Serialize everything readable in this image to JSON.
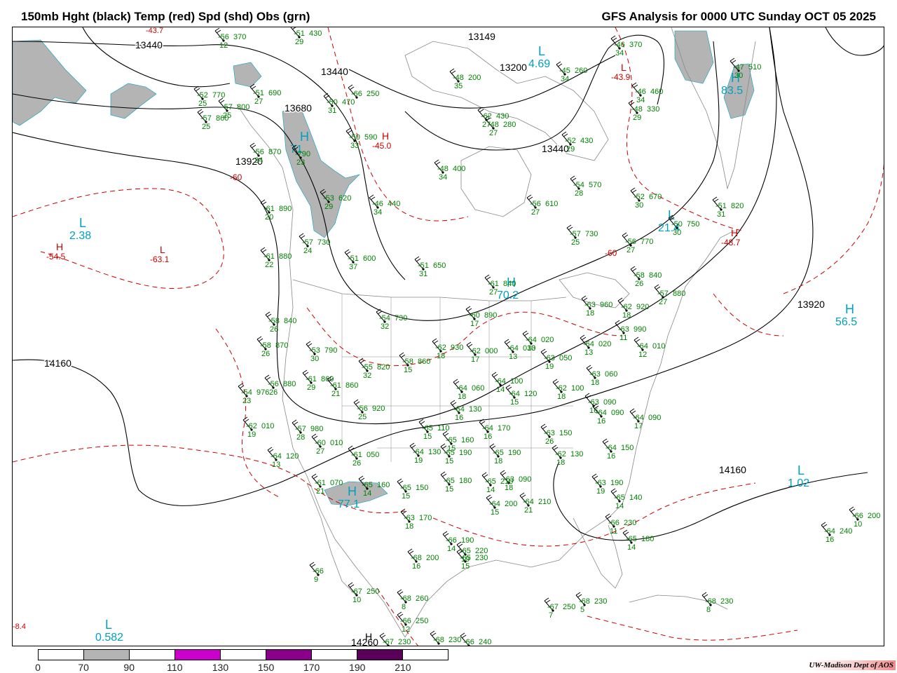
{
  "header": {
    "title_left": "150mb Hght (black) Temp (red) Spd (shd) Obs (grn)",
    "title_right": "GFS Analysis for 0000 UTC Sunday  OCT 05 2025"
  },
  "colors": {
    "height_contours": "#000000",
    "temperature_contours": "#cc0000",
    "observations": "#008000",
    "speed_labels": "#00a0c0",
    "geography": "#888888"
  },
  "height_labels": [
    "13440",
    "13149",
    "13200",
    "13440",
    "13680",
    "13920",
    "13440",
    "14160",
    "14160",
    "14260",
    "13920"
  ],
  "temperature_labels": [
    "-60",
    "-60"
  ],
  "centers": [
    {
      "letter": "L",
      "value": "2.38",
      "color": "cyan"
    },
    {
      "letter": "H",
      "value": "-54.5",
      "color": "red"
    },
    {
      "letter": "L",
      "value": "-63.1",
      "color": "red"
    },
    {
      "letter": "H",
      "value": "-45.0",
      "color": "red"
    },
    {
      "letter": "H",
      "value": "71",
      "color": "cyan"
    },
    {
      "letter": "L",
      "value": "4.69",
      "color": "cyan"
    },
    {
      "letter": "H",
      "value": "83.5",
      "color": "cyan"
    },
    {
      "letter": "H",
      "value": "-48.7",
      "color": "red"
    },
    {
      "letter": "H",
      "value": "70.2",
      "color": "cyan"
    },
    {
      "letter": "H",
      "value": "56.5",
      "color": "cyan"
    },
    {
      "letter": "L",
      "value": "1.02",
      "color": "cyan"
    },
    {
      "letter": "H",
      "value": "77.1",
      "color": "cyan"
    },
    {
      "letter": "L",
      "value": "0.582",
      "color": "cyan"
    },
    {
      "letter": "H",
      "value": "",
      "color": "black"
    },
    {
      "letter": "L",
      "value": "21.4",
      "color": "cyan"
    },
    {
      "letter": "L",
      "value": "-43.9",
      "color": "red"
    }
  ],
  "observations": [
    {
      "temp": "-51",
      "height": "430",
      "dew": "29"
    },
    {
      "temp": "-46",
      "height": "370",
      "dew": "34"
    },
    {
      "temp": "-45",
      "height": "260",
      "dew": "34"
    },
    {
      "temp": "-46",
      "height": "460",
      "dew": "34"
    },
    {
      "temp": "-48",
      "height": "200",
      "dew": "35"
    },
    {
      "temp": "-51",
      "height": "690",
      "dew": "27"
    },
    {
      "temp": "-52",
      "height": "770",
      "dew": "25"
    },
    {
      "temp": "-57",
      "height": "800",
      "dew": "25"
    },
    {
      "temp": "-57",
      "height": "860",
      "dew": "25"
    },
    {
      "temp": "-50",
      "height": "470",
      "dew": "31"
    },
    {
      "temp": "-48",
      "height": "280",
      "dew": "27"
    },
    {
      "temp": "-50",
      "height": "590",
      "dew": "33"
    },
    {
      "temp": "-52",
      "height": "430",
      "dew": "29"
    },
    {
      "temp": "-56",
      "height": "870",
      "dew": "24"
    },
    {
      "temp": "-790",
      "height": "",
      "dew": "23"
    },
    {
      "temp": "-48",
      "height": "400",
      "dew": "34"
    },
    {
      "temp": "-46",
      "height": "440",
      "dew": "34"
    },
    {
      "temp": "-54",
      "height": "570",
      "dew": "28"
    },
    {
      "temp": "-52",
      "height": "670",
      "dew": "30"
    },
    {
      "temp": "-51",
      "height": "820",
      "dew": "31"
    },
    {
      "temp": "-61",
      "height": "890",
      "dew": "20"
    },
    {
      "temp": "-53",
      "height": "620",
      "dew": "29"
    },
    {
      "temp": "-57",
      "height": "730",
      "dew": "24"
    },
    {
      "temp": "-56",
      "height": "610",
      "dew": "27"
    },
    {
      "temp": "-57",
      "height": "730",
      "dew": "25"
    },
    {
      "temp": "-50",
      "height": "750",
      "dew": "30"
    },
    {
      "temp": "-56",
      "height": "770",
      "dew": "27"
    },
    {
      "temp": "-51",
      "height": "600",
      "dew": "37"
    },
    {
      "temp": "-61",
      "height": "880",
      "dew": "22"
    },
    {
      "temp": "-51",
      "height": "650",
      "dew": "31"
    },
    {
      "temp": "-61",
      "height": "840",
      "dew": "27"
    },
    {
      "temp": "-58",
      "height": "840",
      "dew": "26"
    },
    {
      "temp": "-57",
      "height": "880",
      "dew": "27"
    },
    {
      "temp": "-63",
      "height": "960",
      "dew": "18"
    },
    {
      "temp": "-62",
      "height": "920",
      "dew": "18"
    },
    {
      "temp": "-54",
      "height": "730",
      "dew": "32"
    },
    {
      "temp": "-60",
      "height": "890",
      "dew": "17"
    },
    {
      "temp": "-58",
      "height": "840",
      "dew": "26"
    },
    {
      "temp": "-58",
      "height": "870",
      "dew": "26"
    },
    {
      "temp": "-53",
      "height": "790",
      "dew": "30"
    },
    {
      "temp": "-62",
      "height": "930",
      "dew": "18"
    },
    {
      "temp": "-62",
      "height": "000",
      "dew": "17"
    },
    {
      "temp": "-64",
      "height": "030",
      "dew": "13"
    },
    {
      "temp": "-64",
      "height": "020",
      "dew": "13"
    },
    {
      "temp": "-63",
      "height": "990",
      "dew": "11"
    },
    {
      "temp": "-64",
      "height": "020",
      "dew": "13"
    },
    {
      "temp": "-64",
      "height": "010",
      "dew": "12"
    },
    {
      "temp": "-58",
      "height": "860",
      "dew": "15"
    },
    {
      "temp": "-55",
      "height": "820",
      "dew": "32"
    },
    {
      "temp": "-61",
      "height": "860",
      "dew": "29"
    },
    {
      "temp": "-56",
      "height": "880",
      "dew": "26"
    },
    {
      "temp": "-61",
      "height": "860",
      "dew": "21"
    },
    {
      "temp": "-63",
      "height": "050",
      "dew": "19"
    },
    {
      "temp": "-63",
      "height": "060",
      "dew": "18"
    },
    {
      "temp": "-54",
      "height": "976",
      "dew": "23"
    },
    {
      "temp": "-64",
      "height": "060",
      "dew": "18"
    },
    {
      "temp": "-64",
      "height": "100",
      "dew": "14"
    },
    {
      "temp": "-62",
      "height": "100",
      "dew": "18"
    },
    {
      "temp": "-56",
      "height": "920",
      "dew": "25"
    },
    {
      "temp": "-64",
      "height": "120",
      "dew": "15"
    },
    {
      "temp": "-63",
      "height": "090",
      "dew": "16"
    },
    {
      "temp": "-62",
      "height": "010",
      "dew": "19"
    },
    {
      "temp": "-57",
      "height": "980",
      "dew": "28"
    },
    {
      "temp": "-64",
      "height": "130",
      "dew": "16"
    },
    {
      "temp": "-64",
      "height": "090",
      "dew": "16"
    },
    {
      "temp": "-64",
      "height": "090",
      "dew": "17"
    },
    {
      "temp": "-65",
      "height": "110",
      "dew": "15"
    },
    {
      "temp": "-64",
      "height": "170",
      "dew": "16"
    },
    {
      "temp": "-65",
      "height": "160",
      "dew": "15"
    },
    {
      "temp": "-63",
      "height": "150",
      "dew": "26"
    },
    {
      "temp": "-60",
      "height": "010",
      "dew": "27"
    },
    {
      "temp": "-61",
      "height": "050",
      "dew": "26"
    },
    {
      "temp": "-64",
      "height": "130",
      "dew": "19"
    },
    {
      "temp": "-65",
      "height": "190",
      "dew": "15"
    },
    {
      "temp": "-65",
      "height": "190",
      "dew": "18"
    },
    {
      "temp": "-62",
      "height": "130",
      "dew": "18"
    },
    {
      "temp": "-64",
      "height": "150",
      "dew": "16"
    },
    {
      "temp": "-64",
      "height": "120",
      "dew": "13"
    },
    {
      "temp": "-61",
      "height": "070",
      "dew": "21"
    },
    {
      "temp": "-63",
      "height": "090",
      "dew": "18"
    },
    {
      "temp": "-63",
      "height": "190",
      "dew": "19"
    },
    {
      "temp": "-65",
      "height": "140",
      "dew": "14"
    },
    {
      "temp": "-65",
      "height": "160",
      "dew": "14"
    },
    {
      "temp": "-65",
      "height": "150",
      "dew": "15"
    },
    {
      "temp": "-65",
      "height": "180",
      "dew": "15"
    },
    {
      "temp": "-65",
      "height": "210",
      "dew": "14"
    },
    {
      "temp": "-64",
      "height": "200",
      "dew": "15"
    },
    {
      "temp": "-64",
      "height": "210",
      "dew": "21"
    },
    {
      "temp": "-63",
      "height": "170",
      "dew": "18"
    },
    {
      "temp": "-66",
      "height": "230",
      "dew": "11"
    },
    {
      "temp": "-65",
      "height": "180",
      "dew": "14"
    },
    {
      "temp": "-66",
      "height": "190",
      "dew": "14"
    },
    {
      "temp": "-65",
      "height": "220",
      "dew": "19"
    },
    {
      "temp": "-68",
      "height": "200",
      "dew": "16"
    },
    {
      "temp": "-65",
      "height": "230",
      "dew": "15"
    },
    {
      "temp": "-64",
      "height": "240",
      "dew": "16"
    },
    {
      "temp": "-66",
      "height": "200",
      "dew": "10"
    },
    {
      "temp": "-66",
      "height": "",
      "dew": "9"
    },
    {
      "temp": "-67",
      "height": "250",
      "dew": "10"
    },
    {
      "temp": "-68",
      "height": "260",
      "dew": "8"
    },
    {
      "temp": "-66",
      "height": "250",
      "dew": "12"
    },
    {
      "temp": "-67",
      "height": "250",
      "dew": "7"
    },
    {
      "temp": "-68",
      "height": "230",
      "dew": "5"
    },
    {
      "temp": "-68",
      "height": "230",
      "dew": "8"
    },
    {
      "temp": "-68",
      "height": "230",
      "dew": ""
    },
    {
      "temp": "-66",
      "height": "240",
      "dew": ""
    },
    {
      "temp": "-67",
      "height": "230",
      "dew": ""
    },
    {
      "temp": "-66",
      "height": "250",
      "dew": ""
    },
    {
      "temp": "-62",
      "height": "430",
      "dew": "27"
    },
    {
      "temp": "-48",
      "height": "330",
      "dew": "29"
    },
    {
      "temp": "-56",
      "height": "370",
      "dew": "12"
    },
    {
      "temp": "-47",
      "height": "510",
      "dew": "30"
    }
  ],
  "edge_labels": [
    "-8.4",
    "-43.7"
  ],
  "legend": {
    "ticks": [
      "0",
      "70",
      "90",
      "110",
      "130",
      "150",
      "170",
      "190",
      "210"
    ],
    "fills": [
      "#ffffff",
      "#b4b4b4",
      "#ffffff",
      "#cc00cc",
      "#ffffff",
      "#8b008b",
      "#ffffff",
      "#5a005a",
      "#ffffff"
    ]
  },
  "credit": "UW-Madison  Dept of AOS"
}
